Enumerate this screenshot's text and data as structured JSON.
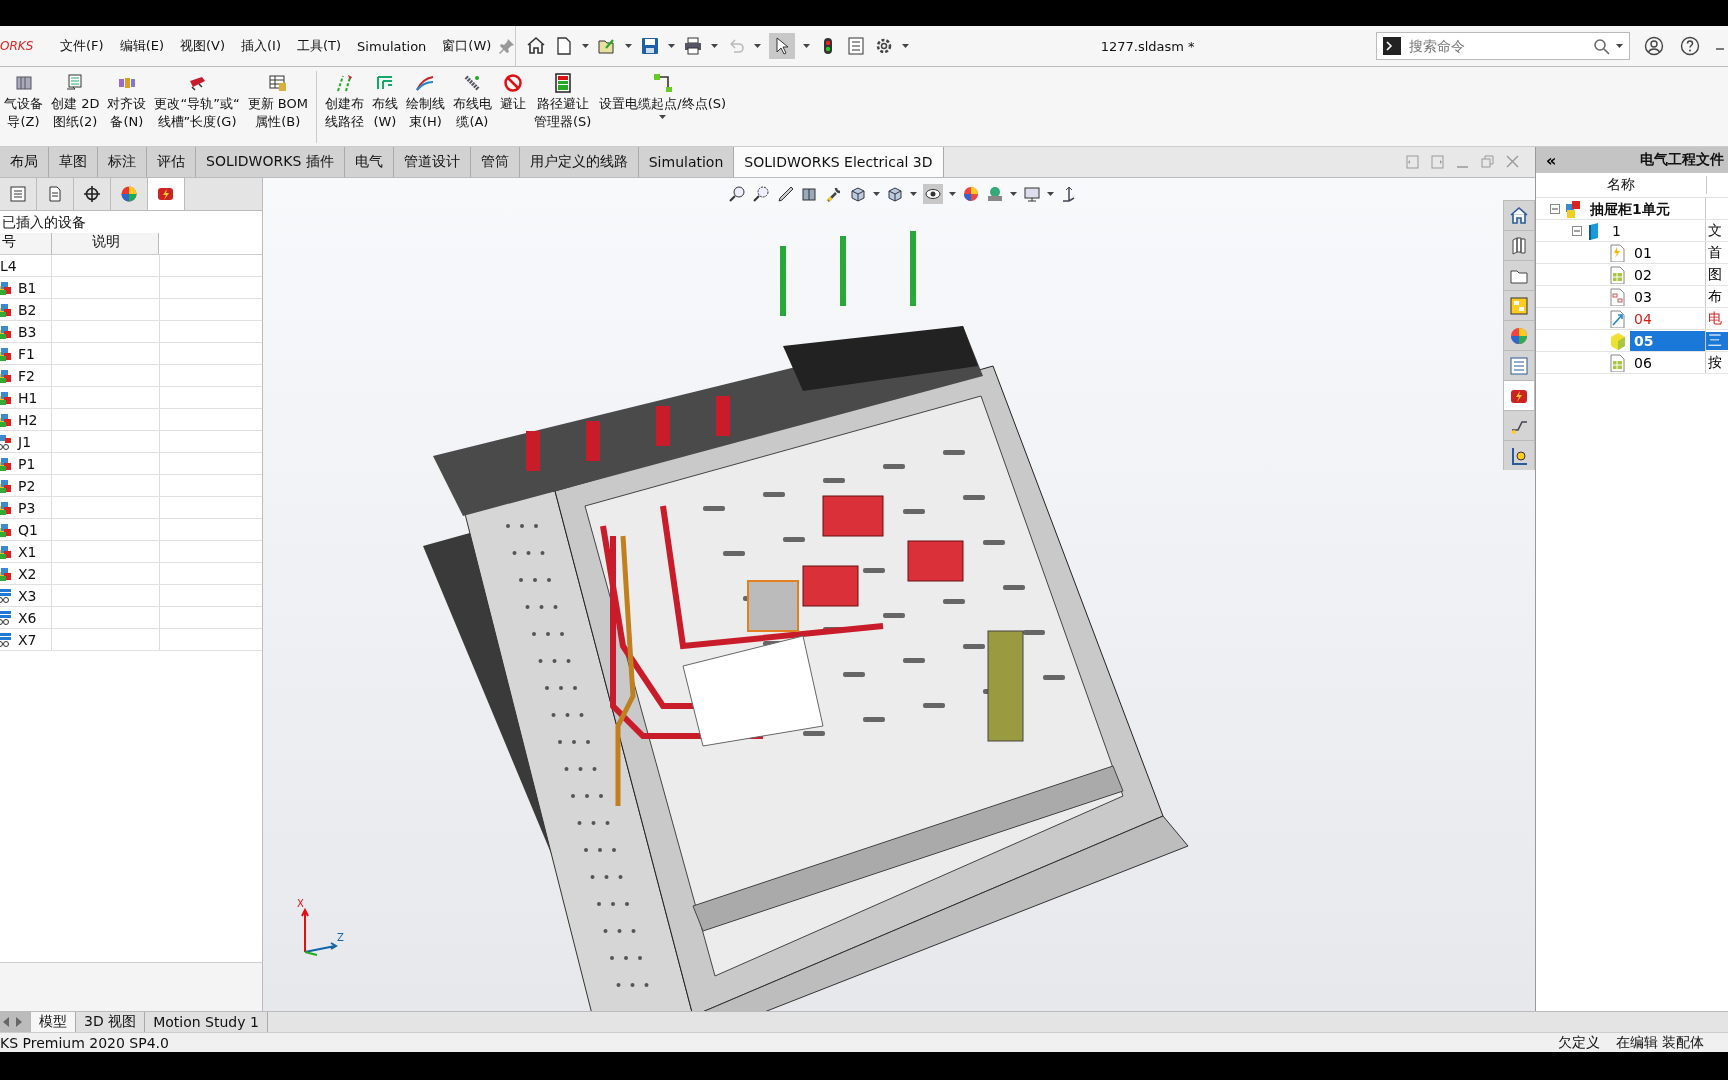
{
  "logo": "ORKS",
  "menu": [
    {
      "label": "文件(F)"
    },
    {
      "label": "编辑(E)"
    },
    {
      "label": "视图(V)"
    },
    {
      "label": "插入(I)"
    },
    {
      "label": "工具(T)"
    },
    {
      "label": "Simulation"
    },
    {
      "label": "窗口(W)"
    }
  ],
  "title": "1277.sldasm *",
  "search": {
    "placeholder": "搜索命令"
  },
  "ribbon": [
    {
      "lines": [
        "气设备",
        "导(Z)"
      ]
    },
    {
      "lines": [
        "创建 2D",
        "图纸(2)"
      ]
    },
    {
      "lines": [
        "对齐设",
        "备(N)"
      ]
    },
    {
      "lines": [
        "更改“导轨”或“",
        "线槽”长度(G)"
      ]
    },
    {
      "lines": [
        "更新 BOM",
        "属性(B)"
      ]
    },
    {
      "lines": [
        "创建布",
        "线路径"
      ]
    },
    {
      "lines": [
        "布线",
        "(W)"
      ]
    },
    {
      "lines": [
        "绘制线",
        "束(H)"
      ]
    },
    {
      "lines": [
        "布线电",
        "缆(A)"
      ]
    },
    {
      "lines": [
        "避让"
      ]
    },
    {
      "lines": [
        "路径避让",
        "管理器(S)"
      ]
    },
    {
      "lines": [
        "设置电缆起点/终点(S)"
      ]
    }
  ],
  "tabs": [
    {
      "label": "布局",
      "selected": false
    },
    {
      "label": "草图",
      "selected": false
    },
    {
      "label": "标注",
      "selected": false
    },
    {
      "label": "评估",
      "selected": false
    },
    {
      "label": "SOLIDWORKS 插件",
      "selected": false
    },
    {
      "label": "电气",
      "selected": false
    },
    {
      "label": "管道设计",
      "selected": false
    },
    {
      "label": "管筒",
      "selected": false
    },
    {
      "label": "用户定义的线路",
      "selected": false
    },
    {
      "label": "Simulation",
      "selected": false
    },
    {
      "label": "SOLIDWORKS Electrical 3D",
      "selected": true
    }
  ],
  "left_panel": {
    "tabs": [
      {
        "selected": false
      },
      {
        "selected": false
      },
      {
        "selected": false
      },
      {
        "selected": false
      },
      {
        "selected": true
      }
    ],
    "title": "已插入的设备",
    "columns": [
      "号",
      "说明"
    ],
    "rows": [
      {
        "tag": "L4",
        "kind": "plain"
      },
      {
        "tag": "B1",
        "kind": "device"
      },
      {
        "tag": "B2",
        "kind": "device"
      },
      {
        "tag": "B3",
        "kind": "device"
      },
      {
        "tag": "F1",
        "kind": "device"
      },
      {
        "tag": "F2",
        "kind": "device"
      },
      {
        "tag": "H1",
        "kind": "device"
      },
      {
        "tag": "H2",
        "kind": "device"
      },
      {
        "tag": "J1",
        "kind": "connector"
      },
      {
        "tag": "P1",
        "kind": "device"
      },
      {
        "tag": "P2",
        "kind": "device"
      },
      {
        "tag": "P3",
        "kind": "device"
      },
      {
        "tag": "Q1",
        "kind": "device"
      },
      {
        "tag": "X1",
        "kind": "device"
      },
      {
        "tag": "X2",
        "kind": "device"
      },
      {
        "tag": "X3",
        "kind": "terminal"
      },
      {
        "tag": "X6",
        "kind": "terminal"
      },
      {
        "tag": "X7",
        "kind": "terminal"
      }
    ]
  },
  "viewport": {
    "triad": [
      "X",
      "Z"
    ]
  },
  "task_pane": {
    "tabs": [
      {
        "selected": false
      },
      {
        "selected": false
      },
      {
        "selected": false
      },
      {
        "selected": false
      },
      {
        "selected": false
      },
      {
        "selected": false
      },
      {
        "selected": true
      },
      {
        "selected": false
      },
      {
        "selected": false
      }
    ]
  },
  "right_panel": {
    "collapse": "«",
    "title": "电气工程文件",
    "column": "名称",
    "tree": [
      {
        "label": "抽屉柜1单元",
        "expanded": true,
        "selected": false,
        "children": [
          {
            "label": "1",
            "column_2": "文",
            "expanded": true,
            "selected": false,
            "children": [
              {
                "label": "01",
                "column_2": "首",
                "selected": false,
                "color": "#000000"
              },
              {
                "label": "02",
                "column_2": "图",
                "selected": false,
                "color": "#000000"
              },
              {
                "label": "03",
                "column_2": "布",
                "selected": false,
                "color": "#000000"
              },
              {
                "label": "04",
                "column_2": "电",
                "selected": false,
                "color": "#d42020"
              },
              {
                "label": "05",
                "column_2": "三",
                "selected": true
              },
              {
                "label": "06",
                "column_2": "按",
                "selected": false,
                "color": "#000000"
              }
            ]
          }
        ]
      }
    ]
  },
  "bottom_tabs": [
    {
      "label": "模型",
      "selected": true
    },
    {
      "label": "3D 视图",
      "selected": false
    },
    {
      "label": "Motion Study 1",
      "selected": false
    }
  ],
  "status": {
    "product": "KS Premium 2020 SP4.0",
    "state": "欠定义",
    "mode": "在编辑 装配体"
  }
}
